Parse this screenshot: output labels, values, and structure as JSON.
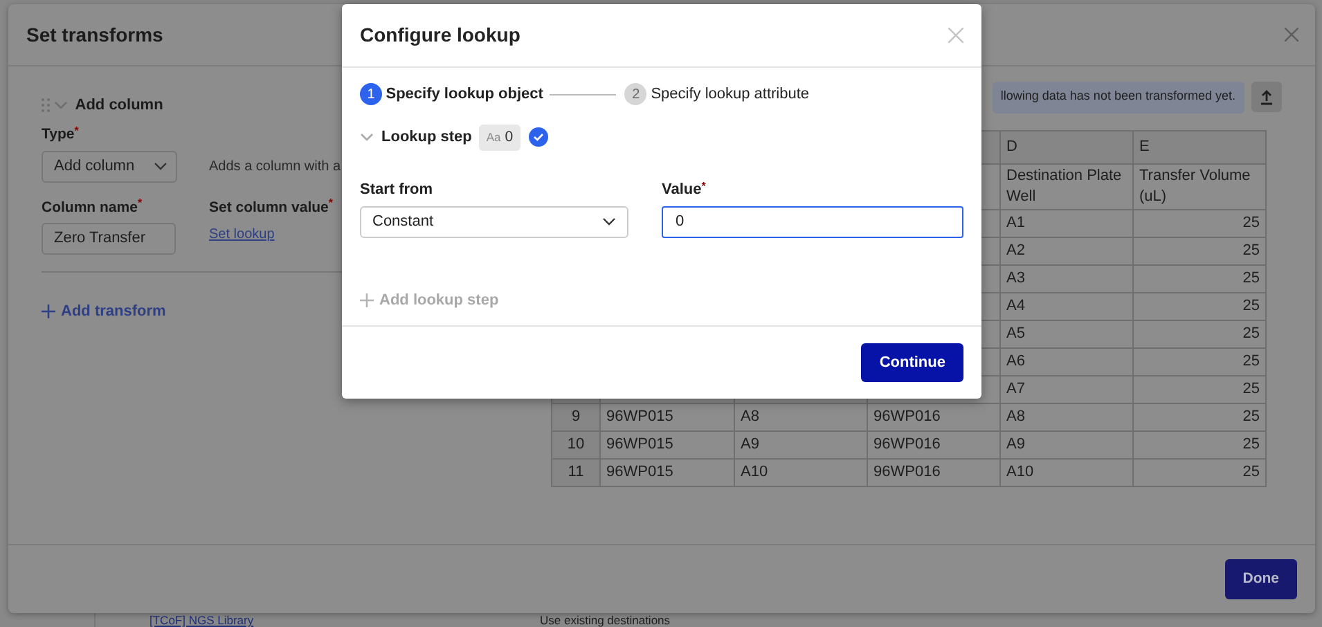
{
  "background_page": {
    "link": "[TCoF] NGS Library",
    "text": "Use existing destinations"
  },
  "transforms_dialog": {
    "title": "Set transforms",
    "transform": {
      "title": "Add column",
      "expanded": true,
      "type_label": "Type$^{*}$",
      "type_value": "Add column",
      "description": "Adds a column with a",
      "column_name_label": "Column name$^{*}$",
      "column_name_value": "Zero Transfer",
      "value_label": "Set column value$^{*}$",
      "value_link": "Set lookup"
    },
    "add_transform": "Add transform",
    "notice": "llowing data has not been transformed yet.",
    "table": {
      "column_letters": [
        "D",
        "E"
      ],
      "column_names": [
        "Destination Plate Well",
        "Transfer Volume (uL)"
      ],
      "rows": [
        {
          "cells": [
            "A1",
            "25"
          ]
        },
        {
          "cells": [
            "A2",
            "25"
          ]
        },
        {
          "cells": [
            "A3",
            "25"
          ]
        },
        {
          "cells": [
            "A4",
            "25"
          ]
        },
        {
          "cells": [
            "A5",
            "25"
          ]
        },
        {
          "cells": [
            "A6",
            "25"
          ]
        },
        {
          "cells": [
            "A7",
            "25"
          ]
        },
        {
          "number": "9",
          "cells": [
            "96WP015",
            "A8",
            "96WP016",
            "A8",
            "25"
          ]
        },
        {
          "number": "10",
          "cells": [
            "96WP015",
            "A9",
            "96WP016",
            "A9",
            "25"
          ]
        },
        {
          "number": "11",
          "cells": [
            "96WP015",
            "A10",
            "96WP016",
            "A10",
            "25"
          ]
        }
      ]
    },
    "done_button": "Done"
  },
  "lookup_dialog": {
    "title": "Configure lookup",
    "steps": [
      {
        "number": "1",
        "label": "Specify lookup object",
        "selected": true
      },
      {
        "number": "2",
        "label": "Specify lookup attribute",
        "selected": false
      }
    ],
    "lookup_step": {
      "title": "Lookup step",
      "expanded": true,
      "badge_glyph": "Aa",
      "badge_count": "0",
      "complete": true
    },
    "start_from": {
      "label": "Start from",
      "value": "Constant"
    },
    "value": {
      "label": "Value$^{*}$",
      "value": "0",
      "focused": true
    },
    "add_lookup_step": {
      "label": "Add lookup step",
      "disabled": true
    },
    "continue_button": "Continue"
  }
}
